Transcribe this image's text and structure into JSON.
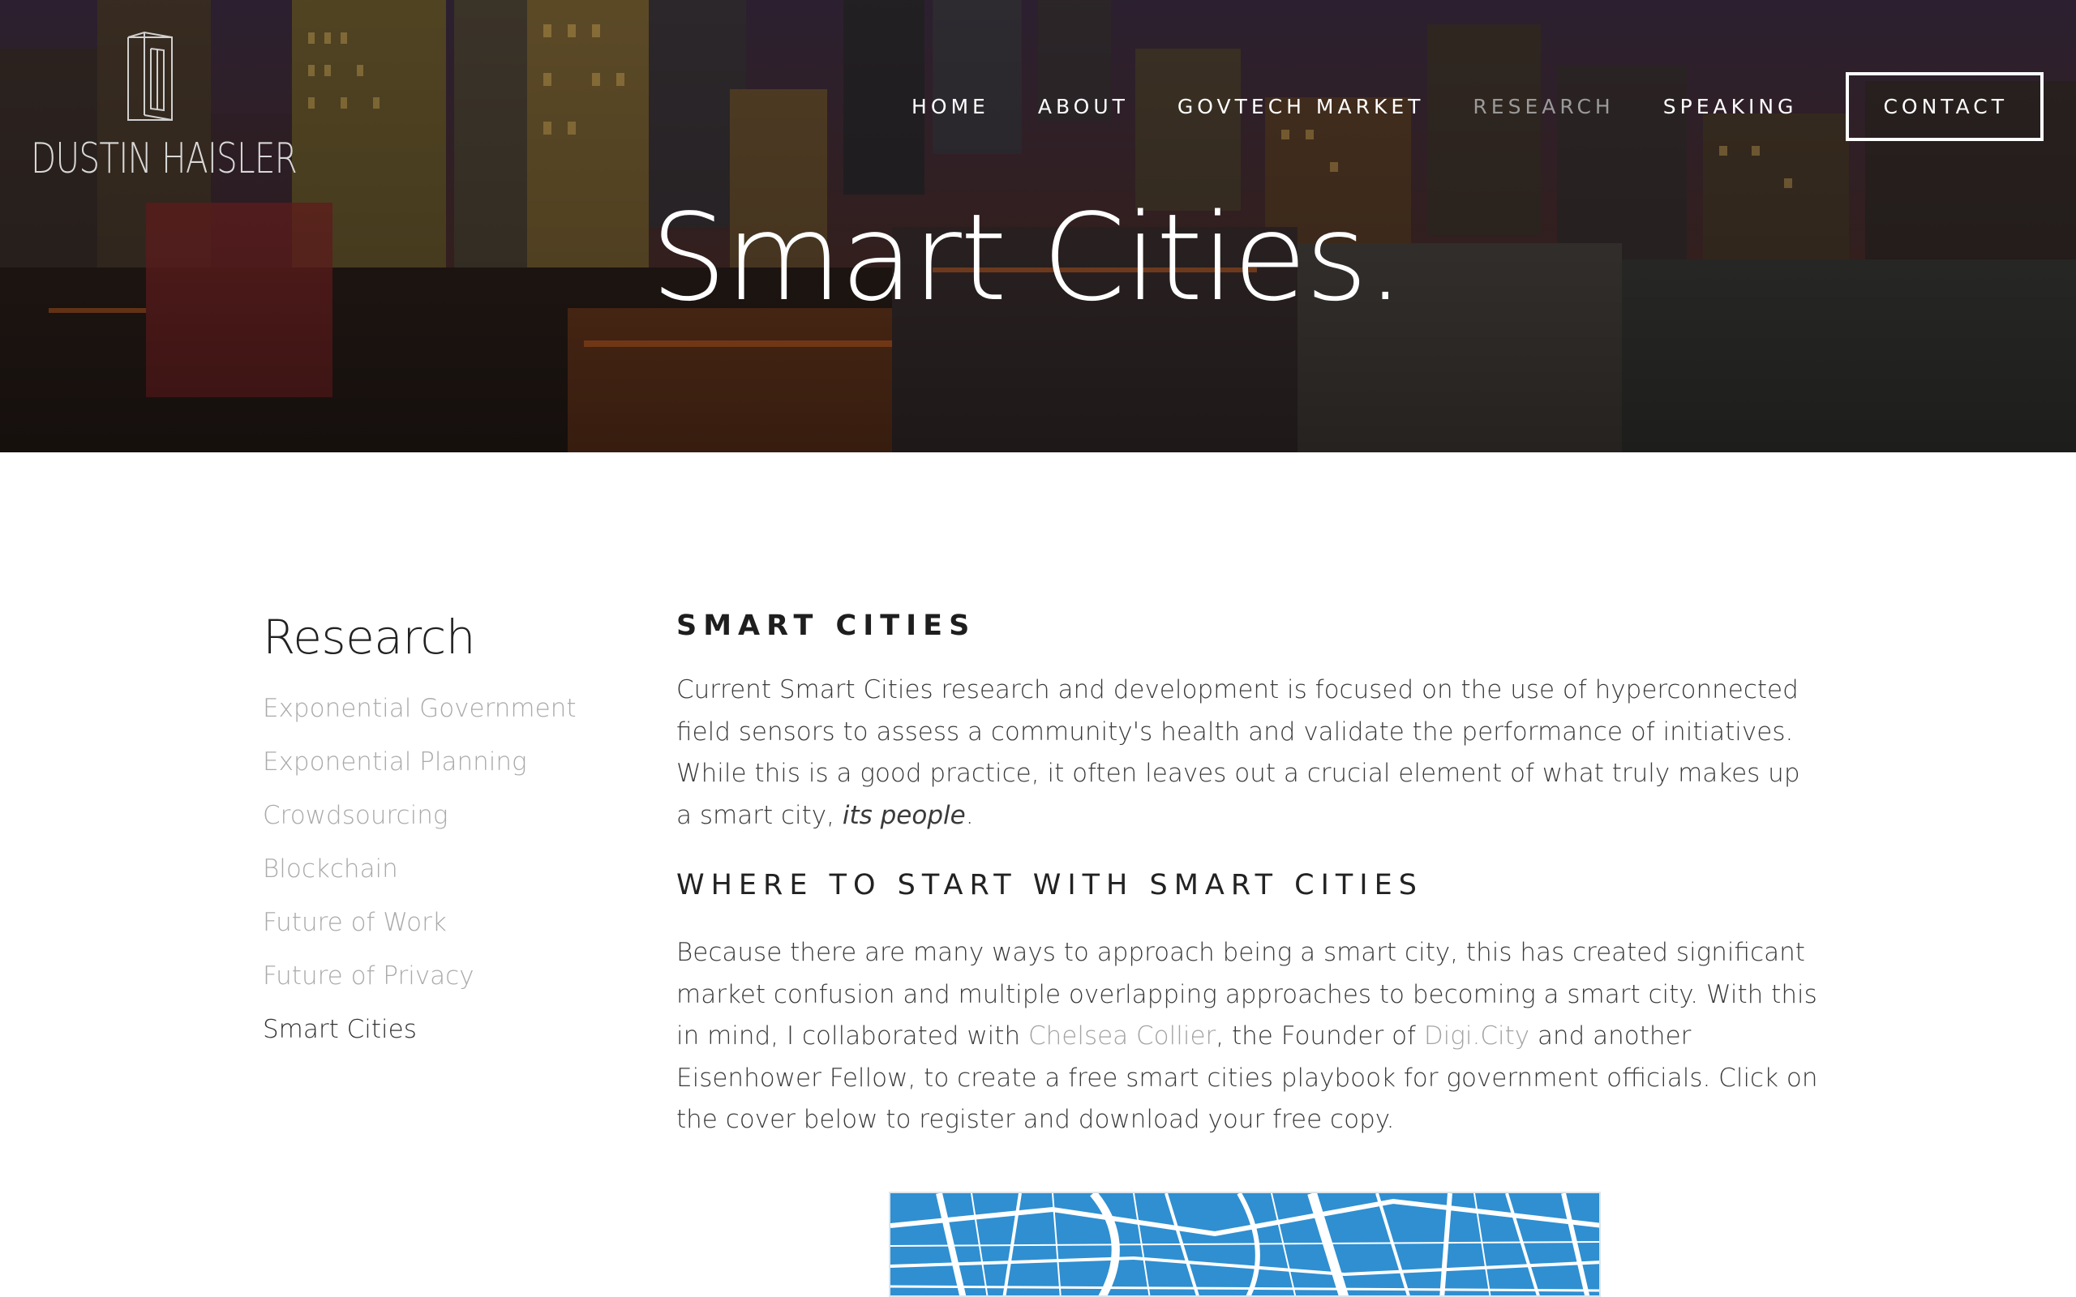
{
  "brand": {
    "name": "DUSTIN HAISLER"
  },
  "nav": {
    "items": [
      {
        "label": "HOME",
        "active": false
      },
      {
        "label": "ABOUT",
        "active": false
      },
      {
        "label": "GOVTECH MARKET",
        "active": false
      },
      {
        "label": "RESEARCH",
        "active": true
      },
      {
        "label": "SPEAKING",
        "active": false
      }
    ],
    "contact_label": "CONTACT"
  },
  "hero": {
    "title": "Smart Cities."
  },
  "sidebar": {
    "heading": "Research",
    "items": [
      {
        "label": "Exponential Government",
        "current": false
      },
      {
        "label": "Exponential Planning",
        "current": false
      },
      {
        "label": "Crowdsourcing",
        "current": false
      },
      {
        "label": "Blockchain",
        "current": false
      },
      {
        "label": "Future of Work",
        "current": false
      },
      {
        "label": "Future of Privacy",
        "current": false
      },
      {
        "label": "Smart Cities",
        "current": true
      }
    ]
  },
  "article": {
    "heading": "SMART CITIES",
    "intro": {
      "text": "Current Smart Cities research and development is focused on the use of hyperconnected field sensors to assess a community's health and validate the performance of initiatives. While this is a good practice, it often leaves out a crucial element of what truly makes up a smart city, ",
      "emphasis": "its people",
      "end": "."
    },
    "subheading": "WHERE TO START WITH SMART CITIES",
    "body": {
      "part1": "Because there are many ways to approach being a smart city, this has created significant market confusion and multiple overlapping approaches to becoming a smart city. With this in mind, I collaborated with ",
      "link1": "Chelsea Collier",
      "part2": ", the Founder of ",
      "link2": "Digi.City",
      "part3": " and another Eisenhower Fellow, to create a free smart cities playbook for government officials. Click on the cover below to register and download your free copy."
    }
  },
  "colors": {
    "accent_link": "#a3a3a3",
    "map_blue": "#2f8fd1"
  },
  "icons": {
    "logo": "building-outline-logo"
  }
}
